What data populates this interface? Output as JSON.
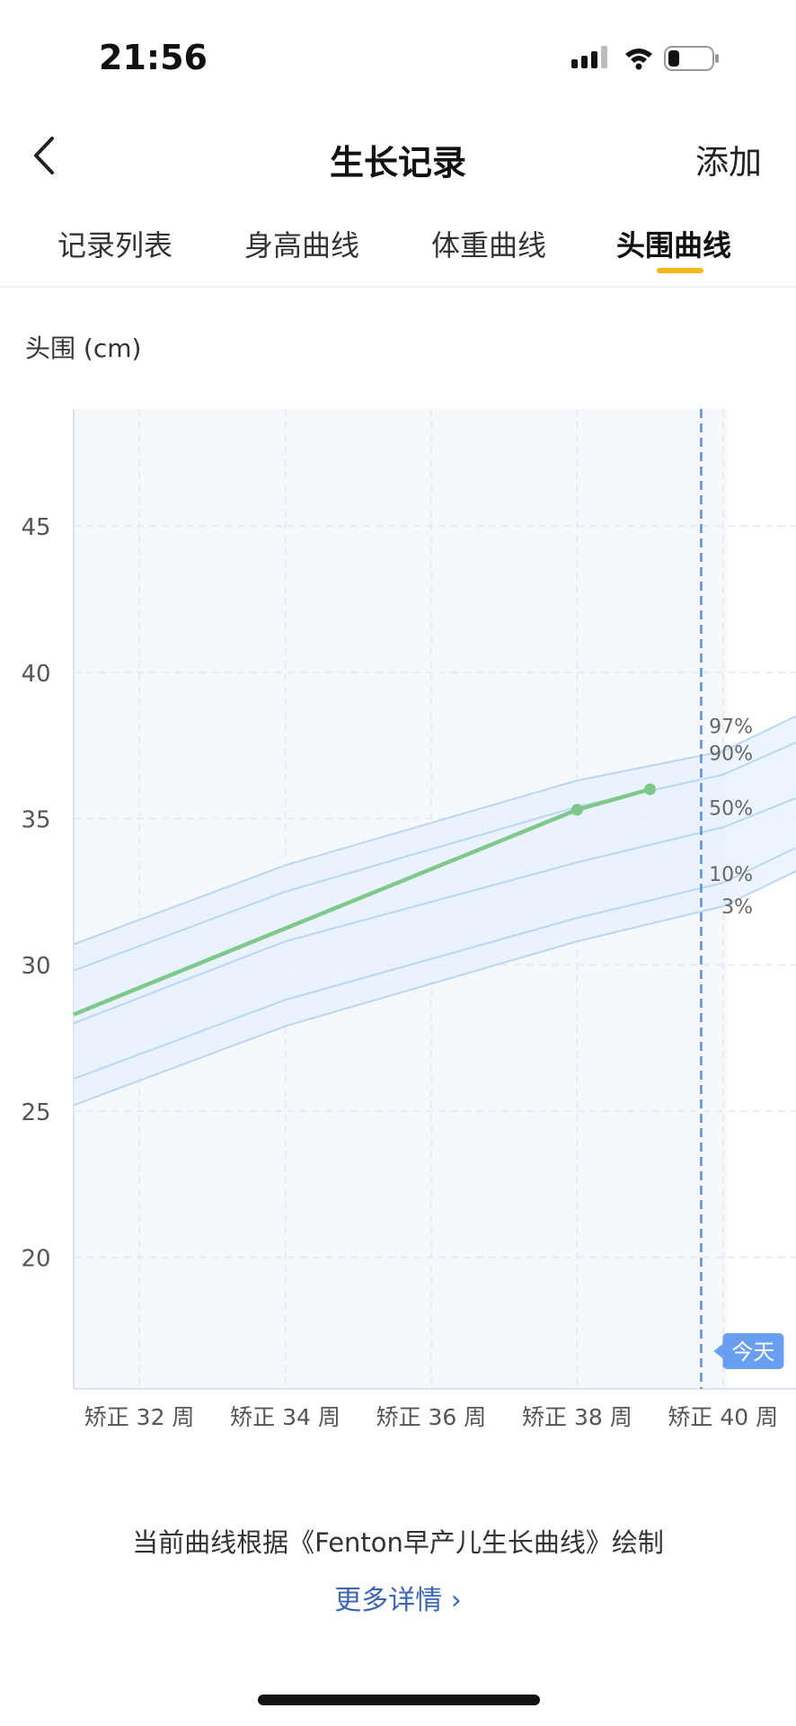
{
  "status_bar": {
    "time": "21:56"
  },
  "nav": {
    "title": "生长记录",
    "add_label": "添加"
  },
  "tabs": [
    {
      "label": "记录列表",
      "active": false
    },
    {
      "label": "身高曲线",
      "active": false
    },
    {
      "label": "体重曲线",
      "active": false
    },
    {
      "label": "头围曲线",
      "active": true
    }
  ],
  "chart_data": {
    "type": "line",
    "ylabel": "头围 (cm)",
    "yticks": [
      20,
      25,
      30,
      35,
      40,
      45
    ],
    "ylim": [
      15.5,
      49
    ],
    "xlim": [
      31.1,
      41
    ],
    "xtick_values": [
      32,
      34,
      36,
      38,
      40
    ],
    "xtick_labels": [
      "矫正 32 周",
      "矫正 34 周",
      "矫正 36 周",
      "矫正 38 周",
      "矫正 40 周"
    ],
    "grid": true,
    "today_label": "今天",
    "today_week": 39.7,
    "percentile_curves": [
      {
        "label": "97%",
        "x": [
          31.1,
          34,
          38,
          40,
          41
        ],
        "y": [
          30.7,
          33.4,
          36.3,
          37.3,
          38.5
        ]
      },
      {
        "label": "90%",
        "x": [
          31.1,
          34,
          38,
          40,
          41
        ],
        "y": [
          29.8,
          32.5,
          35.4,
          36.5,
          37.6
        ]
      },
      {
        "label": "50%",
        "x": [
          31.1,
          34,
          38,
          40,
          41
        ],
        "y": [
          28.0,
          30.8,
          33.5,
          34.7,
          35.7
        ]
      },
      {
        "label": "10%",
        "x": [
          31.1,
          34,
          38,
          40,
          41
        ],
        "y": [
          26.1,
          28.8,
          31.6,
          32.8,
          34.0
        ]
      },
      {
        "label": "3%",
        "x": [
          31.1,
          34,
          38,
          40,
          41
        ],
        "y": [
          25.2,
          27.9,
          30.8,
          32.0,
          33.2
        ]
      }
    ],
    "series": [
      {
        "x": [
          31.1,
          38.0,
          39.0
        ],
        "y": [
          28.3,
          35.3,
          36.0
        ],
        "markers": [
          38.0,
          39.0
        ],
        "color": "#7ec98a"
      }
    ]
  },
  "footer": {
    "source_note": "当前曲线根据《Fenton早产儿生长曲线》绘制",
    "more_link": "更多详情 ›"
  }
}
